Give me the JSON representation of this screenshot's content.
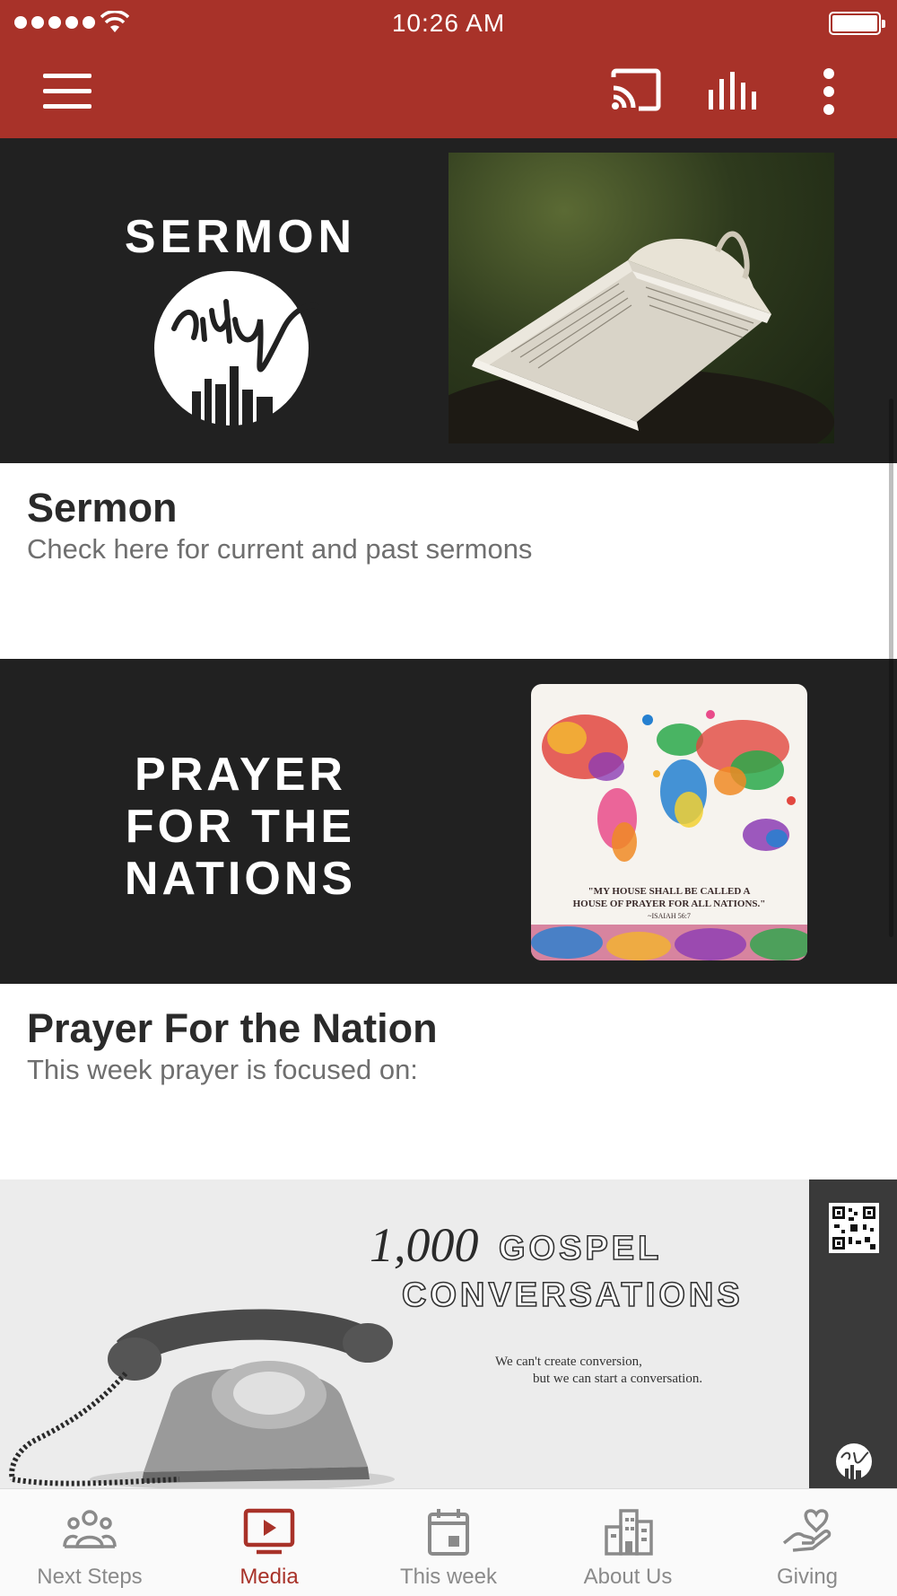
{
  "status_bar": {
    "time": "10:26 AM"
  },
  "colors": {
    "brand": "#a83229",
    "banner_dark": "#212121",
    "active_tab": "#a83229",
    "inactive_tab": "#8a8a8a"
  },
  "app_bar": {
    "menu_icon": "hamburger-menu-icon",
    "cast_icon": "cast-icon",
    "audio_icon": "audio-bars-icon",
    "more_icon": "more-vertical-icon"
  },
  "cards": {
    "sermon": {
      "banner_word": "SERMON",
      "logo_word": "city",
      "title": "Sermon",
      "subtitle": "Check here for current and past sermons"
    },
    "prayer": {
      "banner_lines": [
        "PRAYER",
        "FOR THE",
        "NATIONS"
      ],
      "quote_line1": "\"MY HOUSE SHALL BE CALLED A",
      "quote_line2": "HOUSE OF PRAYER FOR ALL NATIONS.\"",
      "quote_ref": "~ISAIAH 56:7",
      "title": "Prayer For the Nation",
      "subtitle": "This week prayer is focused on:"
    },
    "gospel": {
      "count": "1,000",
      "word1": "GOSPEL",
      "word2": "CONVERSATIONS",
      "tagline1": "We can't create conversion,",
      "tagline2": "but we can start a conversation."
    }
  },
  "bottom_nav": {
    "items": [
      {
        "label": "Next Steps",
        "icon": "people-group-icon",
        "active": false
      },
      {
        "label": "Media",
        "icon": "media-play-icon",
        "active": true
      },
      {
        "label": "This week",
        "icon": "calendar-icon",
        "active": false
      },
      {
        "label": "About Us",
        "icon": "buildings-icon",
        "active": false
      },
      {
        "label": "Giving",
        "icon": "hand-heart-icon",
        "active": false
      }
    ]
  }
}
